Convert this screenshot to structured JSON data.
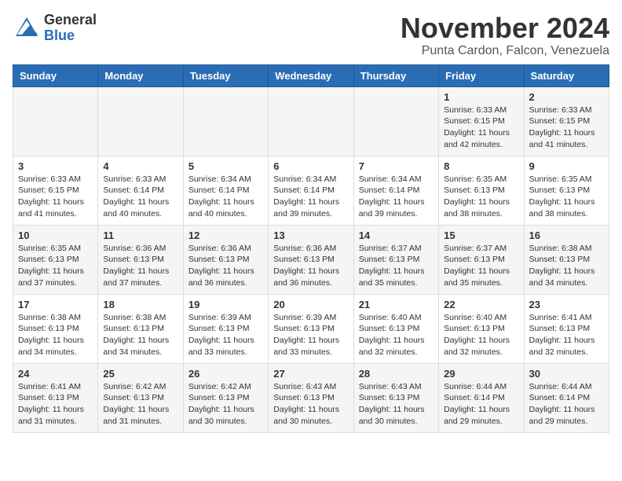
{
  "header": {
    "logo_general": "General",
    "logo_blue": "Blue",
    "title": "November 2024",
    "subtitle": "Punta Cardon, Falcon, Venezuela"
  },
  "weekdays": [
    "Sunday",
    "Monday",
    "Tuesday",
    "Wednesday",
    "Thursday",
    "Friday",
    "Saturday"
  ],
  "weeks": [
    [
      {
        "day": "",
        "info": ""
      },
      {
        "day": "",
        "info": ""
      },
      {
        "day": "",
        "info": ""
      },
      {
        "day": "",
        "info": ""
      },
      {
        "day": "",
        "info": ""
      },
      {
        "day": "1",
        "info": "Sunrise: 6:33 AM\nSunset: 6:15 PM\nDaylight: 11 hours and 42 minutes."
      },
      {
        "day": "2",
        "info": "Sunrise: 6:33 AM\nSunset: 6:15 PM\nDaylight: 11 hours and 41 minutes."
      }
    ],
    [
      {
        "day": "3",
        "info": "Sunrise: 6:33 AM\nSunset: 6:15 PM\nDaylight: 11 hours and 41 minutes."
      },
      {
        "day": "4",
        "info": "Sunrise: 6:33 AM\nSunset: 6:14 PM\nDaylight: 11 hours and 40 minutes."
      },
      {
        "day": "5",
        "info": "Sunrise: 6:34 AM\nSunset: 6:14 PM\nDaylight: 11 hours and 40 minutes."
      },
      {
        "day": "6",
        "info": "Sunrise: 6:34 AM\nSunset: 6:14 PM\nDaylight: 11 hours and 39 minutes."
      },
      {
        "day": "7",
        "info": "Sunrise: 6:34 AM\nSunset: 6:14 PM\nDaylight: 11 hours and 39 minutes."
      },
      {
        "day": "8",
        "info": "Sunrise: 6:35 AM\nSunset: 6:13 PM\nDaylight: 11 hours and 38 minutes."
      },
      {
        "day": "9",
        "info": "Sunrise: 6:35 AM\nSunset: 6:13 PM\nDaylight: 11 hours and 38 minutes."
      }
    ],
    [
      {
        "day": "10",
        "info": "Sunrise: 6:35 AM\nSunset: 6:13 PM\nDaylight: 11 hours and 37 minutes."
      },
      {
        "day": "11",
        "info": "Sunrise: 6:36 AM\nSunset: 6:13 PM\nDaylight: 11 hours and 37 minutes."
      },
      {
        "day": "12",
        "info": "Sunrise: 6:36 AM\nSunset: 6:13 PM\nDaylight: 11 hours and 36 minutes."
      },
      {
        "day": "13",
        "info": "Sunrise: 6:36 AM\nSunset: 6:13 PM\nDaylight: 11 hours and 36 minutes."
      },
      {
        "day": "14",
        "info": "Sunrise: 6:37 AM\nSunset: 6:13 PM\nDaylight: 11 hours and 35 minutes."
      },
      {
        "day": "15",
        "info": "Sunrise: 6:37 AM\nSunset: 6:13 PM\nDaylight: 11 hours and 35 minutes."
      },
      {
        "day": "16",
        "info": "Sunrise: 6:38 AM\nSunset: 6:13 PM\nDaylight: 11 hours and 34 minutes."
      }
    ],
    [
      {
        "day": "17",
        "info": "Sunrise: 6:38 AM\nSunset: 6:13 PM\nDaylight: 11 hours and 34 minutes."
      },
      {
        "day": "18",
        "info": "Sunrise: 6:38 AM\nSunset: 6:13 PM\nDaylight: 11 hours and 34 minutes."
      },
      {
        "day": "19",
        "info": "Sunrise: 6:39 AM\nSunset: 6:13 PM\nDaylight: 11 hours and 33 minutes."
      },
      {
        "day": "20",
        "info": "Sunrise: 6:39 AM\nSunset: 6:13 PM\nDaylight: 11 hours and 33 minutes."
      },
      {
        "day": "21",
        "info": "Sunrise: 6:40 AM\nSunset: 6:13 PM\nDaylight: 11 hours and 32 minutes."
      },
      {
        "day": "22",
        "info": "Sunrise: 6:40 AM\nSunset: 6:13 PM\nDaylight: 11 hours and 32 minutes."
      },
      {
        "day": "23",
        "info": "Sunrise: 6:41 AM\nSunset: 6:13 PM\nDaylight: 11 hours and 32 minutes."
      }
    ],
    [
      {
        "day": "24",
        "info": "Sunrise: 6:41 AM\nSunset: 6:13 PM\nDaylight: 11 hours and 31 minutes."
      },
      {
        "day": "25",
        "info": "Sunrise: 6:42 AM\nSunset: 6:13 PM\nDaylight: 11 hours and 31 minutes."
      },
      {
        "day": "26",
        "info": "Sunrise: 6:42 AM\nSunset: 6:13 PM\nDaylight: 11 hours and 30 minutes."
      },
      {
        "day": "27",
        "info": "Sunrise: 6:43 AM\nSunset: 6:13 PM\nDaylight: 11 hours and 30 minutes."
      },
      {
        "day": "28",
        "info": "Sunrise: 6:43 AM\nSunset: 6:13 PM\nDaylight: 11 hours and 30 minutes."
      },
      {
        "day": "29",
        "info": "Sunrise: 6:44 AM\nSunset: 6:14 PM\nDaylight: 11 hours and 29 minutes."
      },
      {
        "day": "30",
        "info": "Sunrise: 6:44 AM\nSunset: 6:14 PM\nDaylight: 11 hours and 29 minutes."
      }
    ]
  ]
}
